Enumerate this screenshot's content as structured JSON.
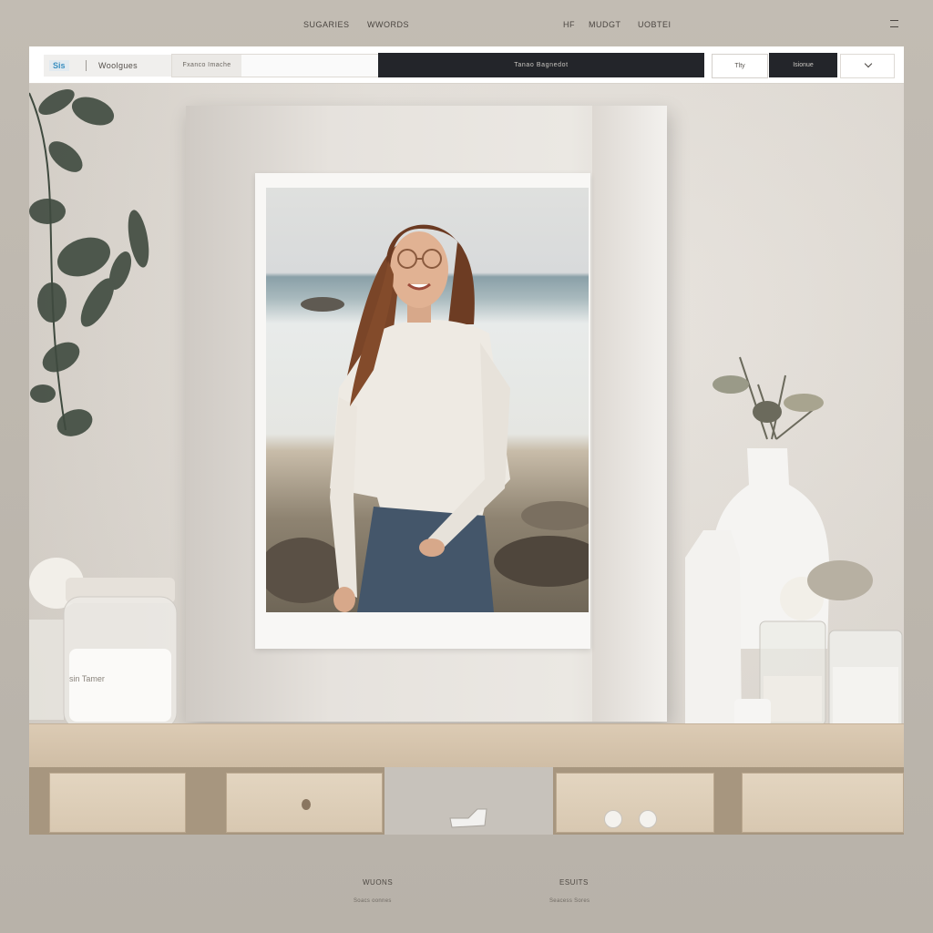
{
  "top_nav": {
    "items": [
      "Sugaries",
      "Wwords",
      "Hf",
      "Mudgt",
      "Uobtei"
    ]
  },
  "toolbar": {
    "logo_mark": "Sis",
    "logo_text": "Woolgues",
    "search_label": "Fxanco Imache",
    "search_placeholder": "",
    "primary_button": "Tanao Bagnedot",
    "secondary_button": "Tlty",
    "dark_button": "Isionue",
    "dropdown_icon": "chevron-down-icon"
  },
  "scene": {
    "jar_label": "sin Tamer"
  },
  "footer": {
    "left_title": "Wuons",
    "left_sub": "Soacs oonnes",
    "right_title": "Esuits",
    "right_sub": "Seacess Sores"
  },
  "colors": {
    "background": "#bdb7ae",
    "toolbar_bg": "#ffffff",
    "dark_button": "#23252a",
    "logo_accent": "#3a8fc0",
    "shelf_wood": "#dccbb4"
  }
}
